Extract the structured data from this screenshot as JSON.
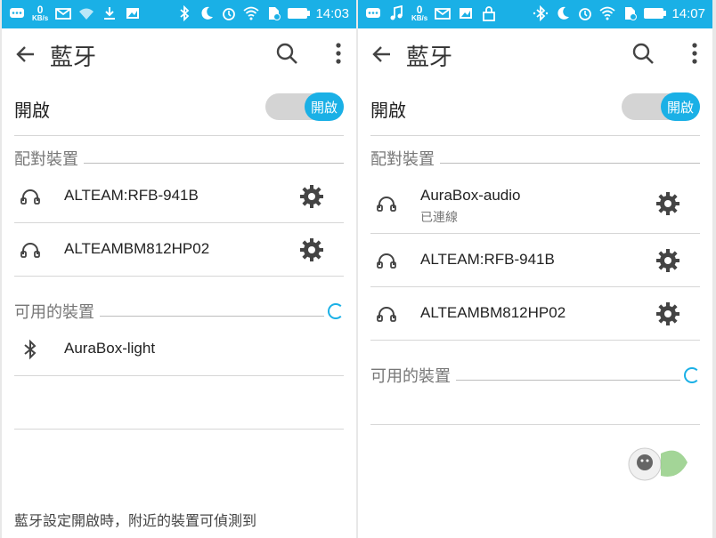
{
  "screens": [
    {
      "clock": "14:03",
      "kbs": "0",
      "kbs_unit": "KB/s",
      "title": "藍牙",
      "toggle_label": "開啟",
      "toggle_state": "開啟",
      "paired_header": "配對裝置",
      "paired": [
        {
          "name": "ALTEAM:RFB-941B",
          "icon": "headset-icon"
        },
        {
          "name": "ALTEAMBM812HP02",
          "icon": "headset-icon"
        }
      ],
      "available_header": "可用的裝置",
      "available": [
        {
          "name": "AuraBox-light",
          "icon": "bluetooth-icon"
        }
      ],
      "footnote": "藍牙設定開啟時，附近的裝置可偵測到"
    },
    {
      "clock": "14:07",
      "kbs": "0",
      "kbs_unit": "KB/s",
      "title": "藍牙",
      "toggle_label": "開啟",
      "toggle_state": "開啟",
      "paired_header": "配對裝置",
      "paired": [
        {
          "name": "AuraBox-audio",
          "status": "已連線",
          "icon": "headset-icon"
        },
        {
          "name": "ALTEAM:RFB-941B",
          "icon": "headset-icon"
        },
        {
          "name": "ALTEAMBM812HP02",
          "icon": "headset-icon"
        }
      ],
      "available_header": "可用的裝置"
    }
  ],
  "colors": {
    "accent": "#1ab0e6",
    "text": "#222222",
    "muted": "#777777"
  }
}
